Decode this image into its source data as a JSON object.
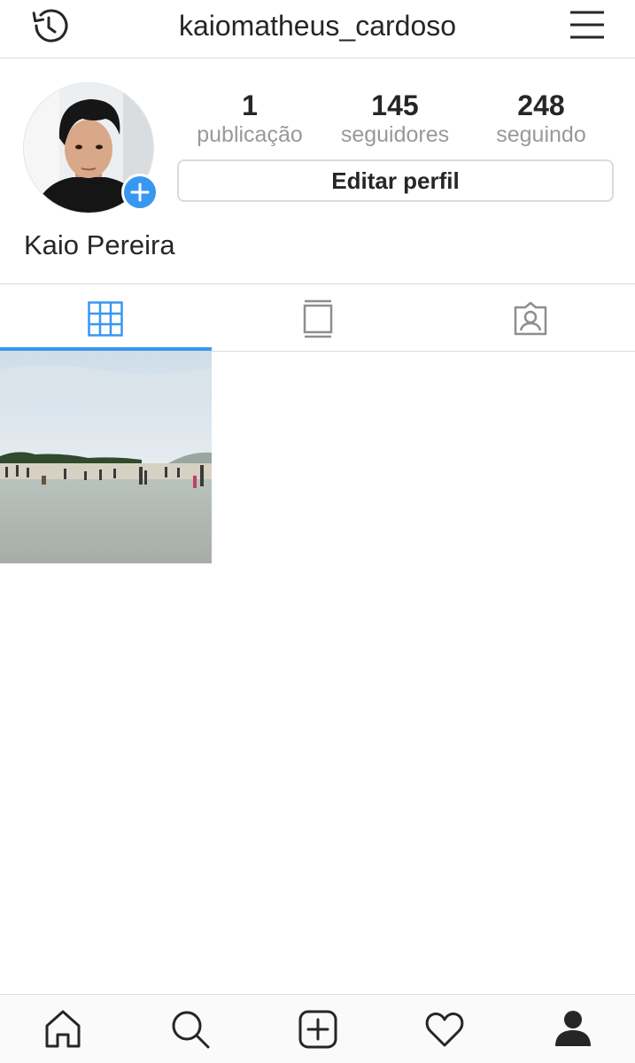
{
  "header": {
    "username": "kaiomatheus_cardoso",
    "left_icon": "history-icon",
    "right_icon": "hamburger-menu-icon"
  },
  "profile": {
    "display_name": "Kaio Pereira",
    "stats": [
      {
        "value": "1",
        "label": "publicação"
      },
      {
        "value": "145",
        "label": "seguidores"
      },
      {
        "value": "248",
        "label": "seguindo"
      }
    ],
    "edit_button_label": "Editar perfil"
  },
  "tabs": [
    {
      "icon": "grid-icon",
      "active": true
    },
    {
      "icon": "feed-view-icon",
      "active": false
    },
    {
      "icon": "tagged-photos-icon",
      "active": false
    }
  ],
  "bottom_nav": [
    {
      "icon": "home-icon"
    },
    {
      "icon": "search-icon"
    },
    {
      "icon": "add-post-icon"
    },
    {
      "icon": "heart-icon"
    },
    {
      "icon": "profile-icon"
    }
  ],
  "colors": {
    "accent": "#3897f0",
    "text": "#262626",
    "secondary_text": "#999999",
    "border": "#dbdbdb"
  }
}
